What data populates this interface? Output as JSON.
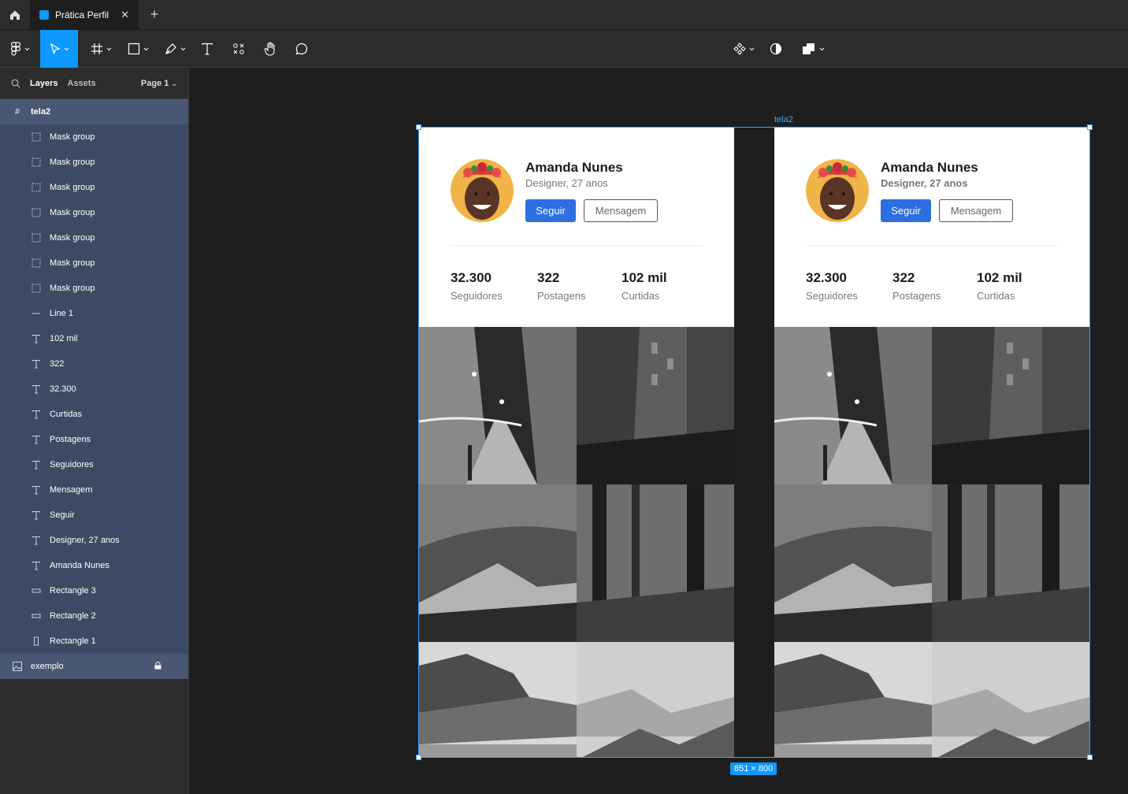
{
  "tabs": {
    "home_icon": "home-icon",
    "active_tab": "Prática Perfil",
    "new_tab": "+"
  },
  "toolbar": {
    "items": [
      "figma-menu",
      "move-tool",
      "frame-tool",
      "shape-tool",
      "pen-tool",
      "text-tool",
      "resources-tool",
      "hand-tool",
      "comment-tool",
      "components",
      "contrast",
      "boolean-ops"
    ]
  },
  "layers_panel": {
    "tab_layers": "Layers",
    "tab_assets": "Assets",
    "page": "Page 1",
    "frame_name": "tela2",
    "children": [
      {
        "icon": "mask",
        "label": "Mask group"
      },
      {
        "icon": "mask",
        "label": "Mask group"
      },
      {
        "icon": "mask",
        "label": "Mask group"
      },
      {
        "icon": "mask",
        "label": "Mask group"
      },
      {
        "icon": "mask",
        "label": "Mask group"
      },
      {
        "icon": "mask",
        "label": "Mask group"
      },
      {
        "icon": "mask",
        "label": "Mask group"
      },
      {
        "icon": "line",
        "label": "Line 1"
      },
      {
        "icon": "text",
        "label": "102 mil"
      },
      {
        "icon": "text",
        "label": "322"
      },
      {
        "icon": "text",
        "label": "32.300"
      },
      {
        "icon": "text",
        "label": "Curtidas"
      },
      {
        "icon": "text",
        "label": "Postagens"
      },
      {
        "icon": "text",
        "label": "Seguidores"
      },
      {
        "icon": "text",
        "label": "Mensagem"
      },
      {
        "icon": "text",
        "label": "Seguir"
      },
      {
        "icon": "text",
        "label": "Designer, 27 anos"
      },
      {
        "icon": "text",
        "label": "Amanda Nunes"
      },
      {
        "icon": "rect",
        "label": "Rectangle 3"
      },
      {
        "icon": "rect",
        "label": "Rectangle 2"
      },
      {
        "icon": "rect-tall",
        "label": "Rectangle 1"
      }
    ],
    "second_frame": "exemplo"
  },
  "canvas": {
    "frame_label": "tela2",
    "size_badge": "851 × 800",
    "profiles": [
      {
        "name": "Amanda Nunes",
        "role": "Designer, 27 anos",
        "follow": "Seguir",
        "message": "Mensagem",
        "stats": [
          {
            "value": "32.300",
            "label": "Seguidores"
          },
          {
            "value": "322",
            "label": "Postagens"
          },
          {
            "value": "102 mil",
            "label": "Curtidas"
          }
        ]
      },
      {
        "name": "Amanda Nunes",
        "role": "Designer, 27 anos",
        "follow": "Seguir",
        "message": "Mensagem",
        "stats": [
          {
            "value": "32.300",
            "label": "Seguidores"
          },
          {
            "value": "322",
            "label": "Postagens"
          },
          {
            "value": "102 mil",
            "label": "Curtidas"
          }
        ]
      }
    ]
  }
}
